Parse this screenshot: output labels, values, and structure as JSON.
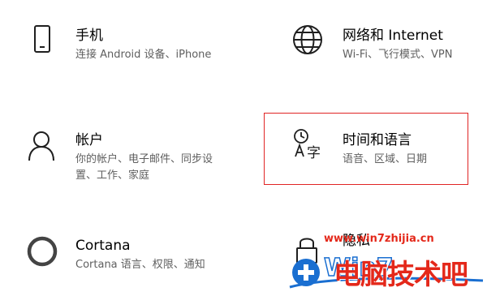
{
  "tiles": [
    {
      "title": "手机",
      "desc_lines": [
        "连接 Android 设备、iPhone"
      ],
      "icon": "phone-icon"
    },
    {
      "title": "网络和 Internet",
      "desc_lines": [
        "Wi-Fi、飞行模式、VPN"
      ],
      "icon": "globe-icon"
    },
    {
      "title": "帐户",
      "desc_lines": [
        "你的帐户、电子邮件、同步设",
        "置、工作、家庭"
      ],
      "icon": "person-icon"
    },
    {
      "title": "时间和语言",
      "desc_lines": [
        "语音、区域、日期"
      ],
      "icon": "time-language-icon",
      "selected": true
    },
    {
      "title": "Cortana",
      "desc_lines": [
        "Cortana 语言、权限、通知"
      ],
      "icon": "cortana-icon"
    },
    {
      "title": "隐私",
      "desc_lines": [],
      "icon": "lock-icon"
    }
  ],
  "watermark": {
    "url": "www.win7zhijia.cn",
    "brand": "电脑技术吧",
    "logo_text": "Win7"
  },
  "colors": {
    "selection_border": "#e02424",
    "description_text": "#5f5f5f",
    "watermark_red": "#e4281a",
    "watermark_blue": "#1a6fd1"
  }
}
